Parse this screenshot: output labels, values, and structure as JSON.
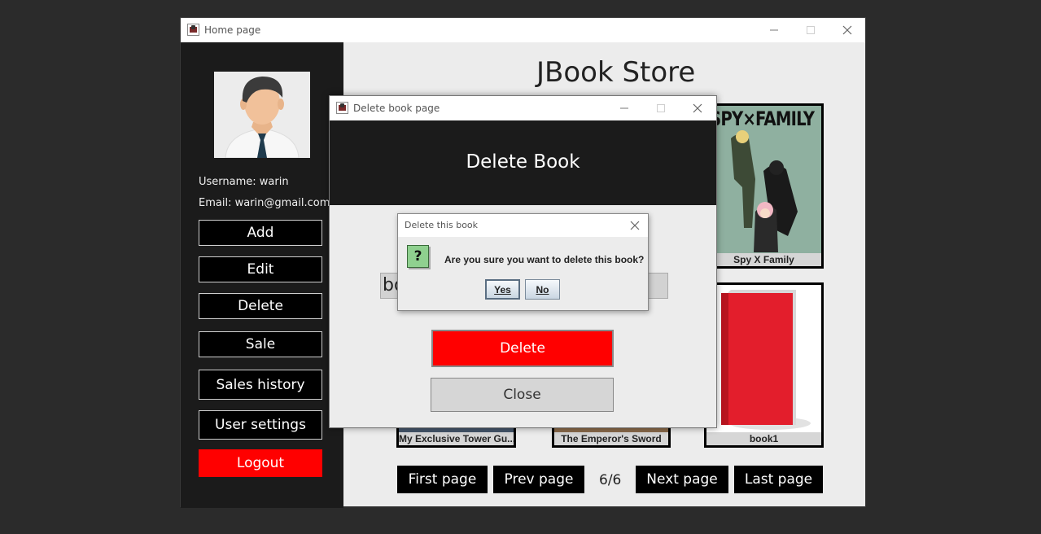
{
  "main_window": {
    "title": "Home page",
    "store_title": "JBook Store"
  },
  "sidebar": {
    "username_text": "Username: warin",
    "email_text": "Email: warin@gmail.com",
    "buttons": {
      "add": "Add",
      "edit": "Edit",
      "delete": "Delete",
      "sale": "Sale",
      "sales_history": "Sales history",
      "user_settings": "User settings",
      "logout": "Logout"
    }
  },
  "books": [
    {
      "title": "Spy X Family"
    },
    {
      "title": "My Exclusive Tower Gu..."
    },
    {
      "title": "The Emperor's Sword"
    },
    {
      "title": "book1"
    }
  ],
  "pagination": {
    "first": "First page",
    "prev": "Prev page",
    "indicator": "6/6",
    "next": "Next page",
    "last": "Last page"
  },
  "delete_window": {
    "title": "Delete book page",
    "heading": "Delete Book",
    "field_value": "bo",
    "delete_label": "Delete",
    "close_label": "Close"
  },
  "confirm_dialog": {
    "title": "Delete this book",
    "message": "Are you sure you want to delete this book?",
    "icon_glyph": "?",
    "yes": "Yes",
    "no": "No"
  },
  "colors": {
    "accent_red": "#ff0000",
    "sidebar_bg": "#1b1b1b",
    "content_bg": "#ececec"
  },
  "icons": [
    "app-icon",
    "minimize-icon",
    "maximize-icon",
    "close-icon",
    "question-icon",
    "avatar"
  ]
}
